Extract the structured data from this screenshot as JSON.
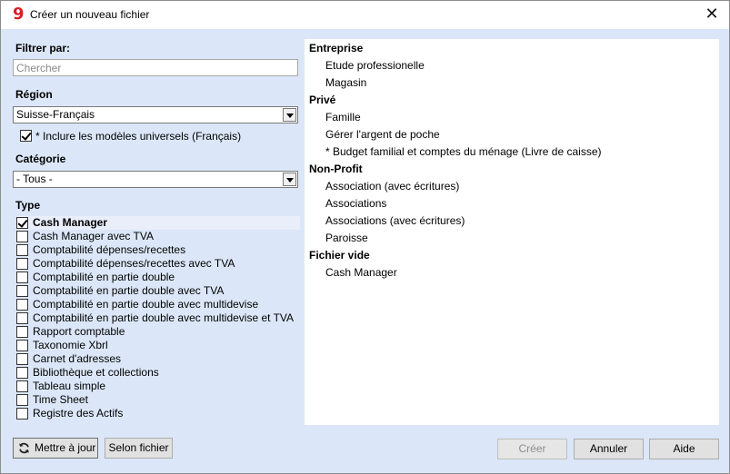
{
  "window": {
    "title": "Créer un nouveau fichier",
    "close_glyph": "✕",
    "app_icon": "banana-9-icon",
    "app_icon_glyph": "9",
    "accent_color": "#d61f26"
  },
  "filter": {
    "label": "Filtrer par:",
    "search_placeholder": "Chercher",
    "search_value": ""
  },
  "region": {
    "label": "Région",
    "selected": "Suisse-Français",
    "include_universal_label": "* Inclure les modèles universels (Français)",
    "include_universal_checked": true
  },
  "category": {
    "label": "Catégorie",
    "selected": "- Tous -"
  },
  "type": {
    "label": "Type",
    "items": [
      {
        "label": "Cash Manager",
        "checked": true
      },
      {
        "label": "Cash Manager avec TVA",
        "checked": false
      },
      {
        "label": "Comptabilité dépenses/recettes",
        "checked": false
      },
      {
        "label": "Comptabilité dépenses/recettes avec TVA",
        "checked": false
      },
      {
        "label": "Comptabilité en partie double",
        "checked": false
      },
      {
        "label": "Comptabilité en partie double avec TVA",
        "checked": false
      },
      {
        "label": "Comptabilité en partie double avec multidevise",
        "checked": false
      },
      {
        "label": "Comptabilité en partie double avec multidevise et TVA",
        "checked": false
      },
      {
        "label": "Rapport comptable",
        "checked": false
      },
      {
        "label": "Taxonomie Xbrl",
        "checked": false
      },
      {
        "label": "Carnet d'adresses",
        "checked": false
      },
      {
        "label": "Bibliothèque et collections",
        "checked": false
      },
      {
        "label": "Tableau simple",
        "checked": false
      },
      {
        "label": "Time Sheet",
        "checked": false
      },
      {
        "label": "Registre des Actifs",
        "checked": false
      }
    ]
  },
  "templates": {
    "groups": [
      {
        "name": "Entreprise",
        "items": [
          "Etude professionelle",
          "Magasin"
        ]
      },
      {
        "name": "Privé",
        "items": [
          "Famille",
          "Gérer l'argent de poche",
          "* Budget familial et comptes du ménage (Livre de caisse)"
        ]
      },
      {
        "name": "Non-Profit",
        "items": [
          "Association (avec écritures)",
          "Associations",
          "Associations (avec écritures)",
          "Paroisse"
        ]
      },
      {
        "name": "Fichier vide",
        "items": [
          "Cash Manager"
        ]
      }
    ]
  },
  "buttons": {
    "update": "Mettre à jour",
    "by_file": "Selon fichier",
    "create": "Créer",
    "cancel": "Annuler",
    "help": "Aide"
  }
}
